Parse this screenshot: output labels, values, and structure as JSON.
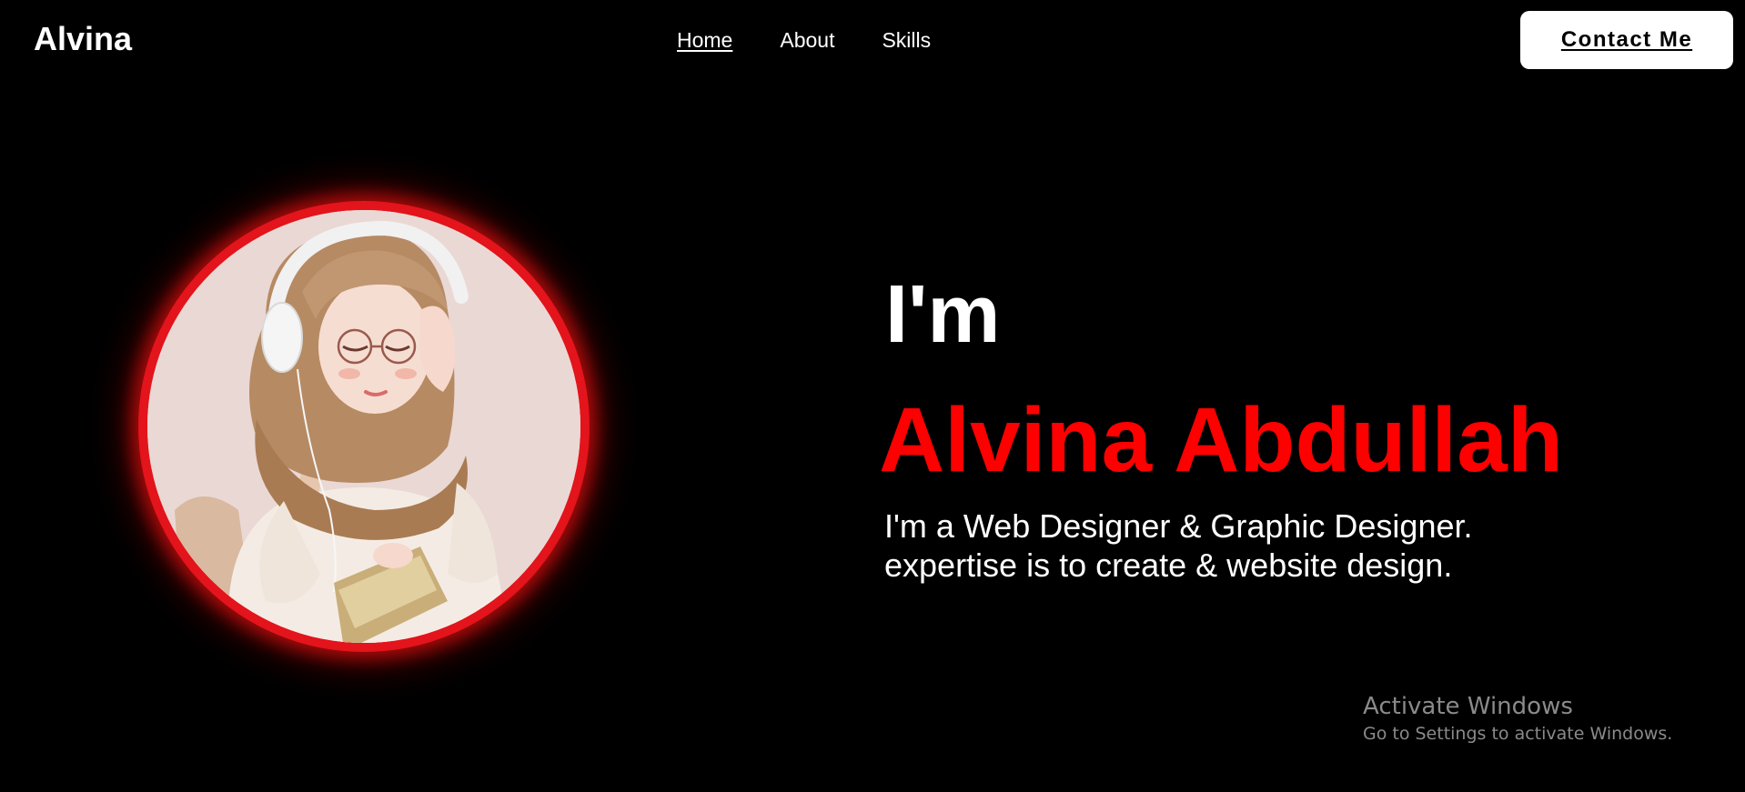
{
  "header": {
    "logo": "Alvina",
    "nav": [
      {
        "label": "Home",
        "active": true
      },
      {
        "label": "About",
        "active": false
      },
      {
        "label": "Skills",
        "active": false
      }
    ],
    "contact_label": "Contact Me"
  },
  "hero": {
    "greeting": "I'm",
    "name": "Alvina Abdullah",
    "description_lines": [
      "I'm a Web Designer & Graphic Designer.",
      "expertise is to create & website design."
    ],
    "accent_color": "#ff0000",
    "avatar_icon": "profile-illustration"
  },
  "watermark": {
    "title": "Activate Windows",
    "subtitle": "Go to Settings to activate Windows."
  }
}
